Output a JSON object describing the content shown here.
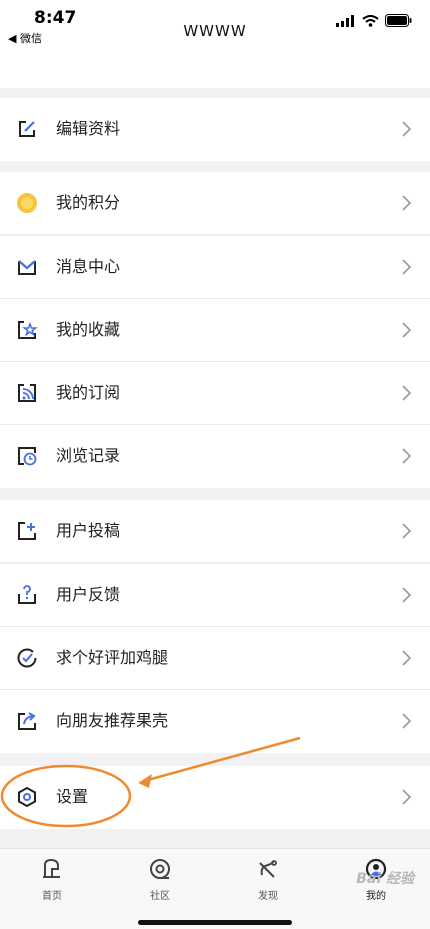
{
  "status_bar": {
    "time": "8:47",
    "back_label": "◀ 微信"
  },
  "nav": {
    "title": "WWWW"
  },
  "rows": [
    {
      "label": "编辑资料",
      "icon": "edit-icon"
    },
    {
      "label": "我的积分",
      "icon": "points-coin-icon"
    },
    {
      "label": "消息中心",
      "icon": "message-icon"
    },
    {
      "label": "我的收藏",
      "icon": "favorites-star-icon"
    },
    {
      "label": "我的订阅",
      "icon": "subscription-rss-icon"
    },
    {
      "label": "浏览记录",
      "icon": "history-clock-icon"
    },
    {
      "label": "用户投稿",
      "icon": "submit-plus-icon"
    },
    {
      "label": "用户反馈",
      "icon": "feedback-question-icon"
    },
    {
      "label": "求个好评加鸡腿",
      "icon": "rate-check-icon"
    },
    {
      "label": "向朋友推荐果壳",
      "icon": "share-icon"
    },
    {
      "label": "设置",
      "icon": "settings-gear-icon"
    }
  ],
  "tabs": [
    {
      "label": "首页",
      "icon": "home-tab-icon"
    },
    {
      "label": "社区",
      "icon": "community-tab-icon"
    },
    {
      "label": "发现",
      "icon": "discover-tab-icon"
    },
    {
      "label": "我的",
      "icon": "profile-tab-icon"
    }
  ],
  "watermark": "Bai 经验",
  "colors": {
    "accent": "#4a6fe3",
    "coin": "#f6c33a",
    "annotation": "#f08a30"
  }
}
